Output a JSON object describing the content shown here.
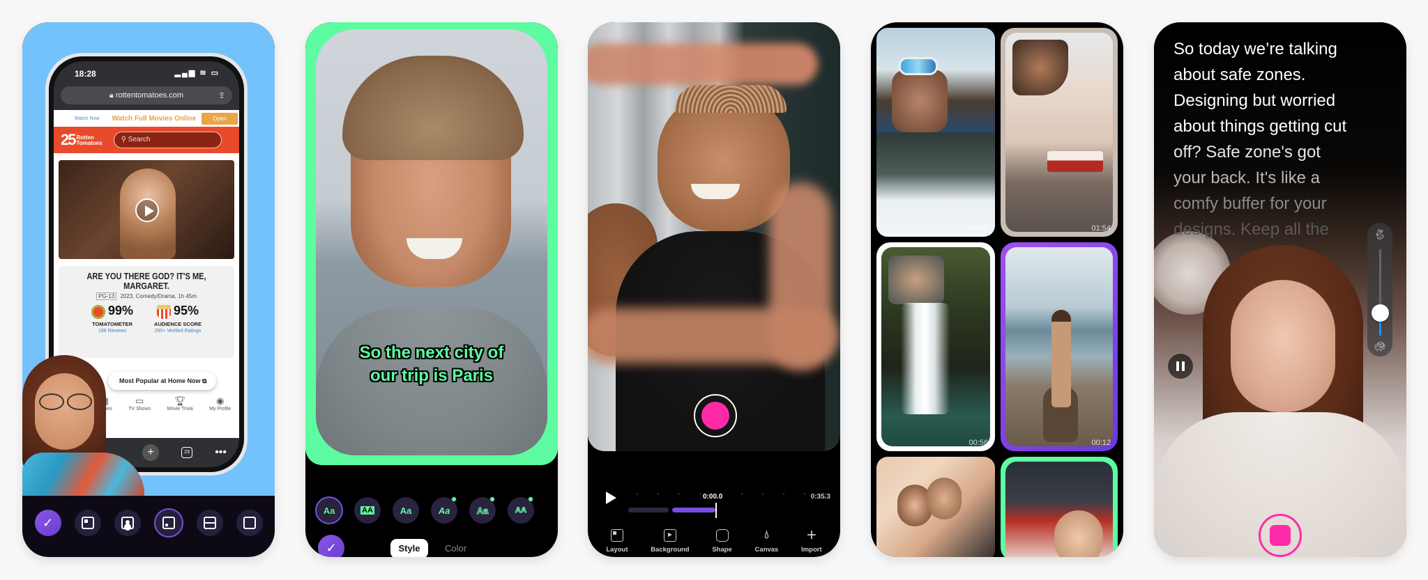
{
  "colors": {
    "accent_purple": "#7a4ee0",
    "record_pink": "#ff2aa8",
    "caption_green": "#5dfca0",
    "panel1_bg": "#74c2fc",
    "rt_red": "#e84a2b"
  },
  "panel1": {
    "phone": {
      "time": "18:28",
      "status_icons": "signal-icon wifi-icon battery-icon",
      "url": "rottentomatoes.com",
      "ad": {
        "small_label": "Watch Now",
        "text": "Watch Full Movies Online",
        "button": "Open"
      },
      "site_logo": {
        "number": "25",
        "line1": "Rotten",
        "line2": "Tomatoes"
      },
      "search_placeholder": "Search",
      "movie": {
        "title": "ARE YOU THERE GOD? IT'S ME, MARGARET.",
        "rating": "PG-13",
        "meta": "2023, Comedy/Drama, 1h 45m",
        "tomatometer": {
          "value": "99%",
          "label": "TOMATOMETER",
          "sub": "188 Reviews"
        },
        "audience": {
          "value": "95%",
          "label": "AUDIENCE SCORE",
          "sub": "250+ Verified Ratings"
        }
      },
      "popular_button": "Most Popular at Home Now",
      "nav": [
        {
          "icon": "film-icon",
          "label": "Movies"
        },
        {
          "icon": "tv-icon",
          "label": "TV Shows"
        },
        {
          "icon": "trophy-icon",
          "label": "Movie Trivia"
        },
        {
          "icon": "profile-icon",
          "label": "My Profile"
        }
      ],
      "tab_count": "23"
    },
    "toolbar": [
      {
        "name": "confirm",
        "icon": "check-icon",
        "selected": false
      },
      {
        "name": "layout-corner",
        "icon": "layout-corner-icon",
        "selected": false
      },
      {
        "name": "layout-person",
        "icon": "layout-person-icon",
        "selected": false
      },
      {
        "name": "layout-pip",
        "icon": "layout-pip-icon",
        "selected": true
      },
      {
        "name": "layout-split",
        "icon": "layout-split-icon",
        "selected": false
      },
      {
        "name": "layout-full",
        "icon": "layout-full-icon",
        "selected": false
      }
    ]
  },
  "panel2": {
    "caption_line1": "So the next city of",
    "caption_line2": "our trip is Paris",
    "styles": [
      {
        "label": "Aa",
        "selected": true,
        "premium": false
      },
      {
        "label": "AA",
        "selected": false,
        "premium": false
      },
      {
        "label": "Aa",
        "selected": false,
        "premium": false
      },
      {
        "label": "Aa",
        "selected": false,
        "premium": true
      },
      {
        "label": "Aa",
        "selected": false,
        "premium": true
      },
      {
        "label": "AA",
        "selected": false,
        "premium": true
      }
    ],
    "tabs": {
      "style": "Style",
      "color": "Color"
    },
    "active_tab": "Style"
  },
  "panel3": {
    "timeline": {
      "current": "0:00.0",
      "end": "0:35.3"
    },
    "tools": [
      {
        "label": "Layout",
        "icon": "layout-icon"
      },
      {
        "label": "Background",
        "icon": "background-icon"
      },
      {
        "label": "Shape",
        "icon": "shape-icon"
      },
      {
        "label": "Canvas",
        "icon": "drop-icon"
      },
      {
        "label": "Import",
        "icon": "plus-icon"
      }
    ]
  },
  "panel4": {
    "tiles": [
      {
        "name": "ski",
        "duration": "00:32"
      },
      {
        "name": "prague",
        "duration": "01:54"
      },
      {
        "name": "waterfall",
        "duration": "00:56"
      },
      {
        "name": "beach",
        "duration": "00:12"
      },
      {
        "name": "couple",
        "duration": ""
      },
      {
        "name": "eating",
        "duration": ""
      }
    ]
  },
  "panel5": {
    "teleprompter_lines": [
      "So today we’re talking",
      "about safe zones.",
      "Designing but worried",
      "about things getting cut",
      "off? Safe zone's got",
      "your back. It's like a",
      "comfy buffer for your",
      "designs. Keep all the"
    ],
    "speed": {
      "fast_icon": "rabbit-icon",
      "slow_icon": "turtle-icon",
      "value_fraction": 0.27
    }
  }
}
